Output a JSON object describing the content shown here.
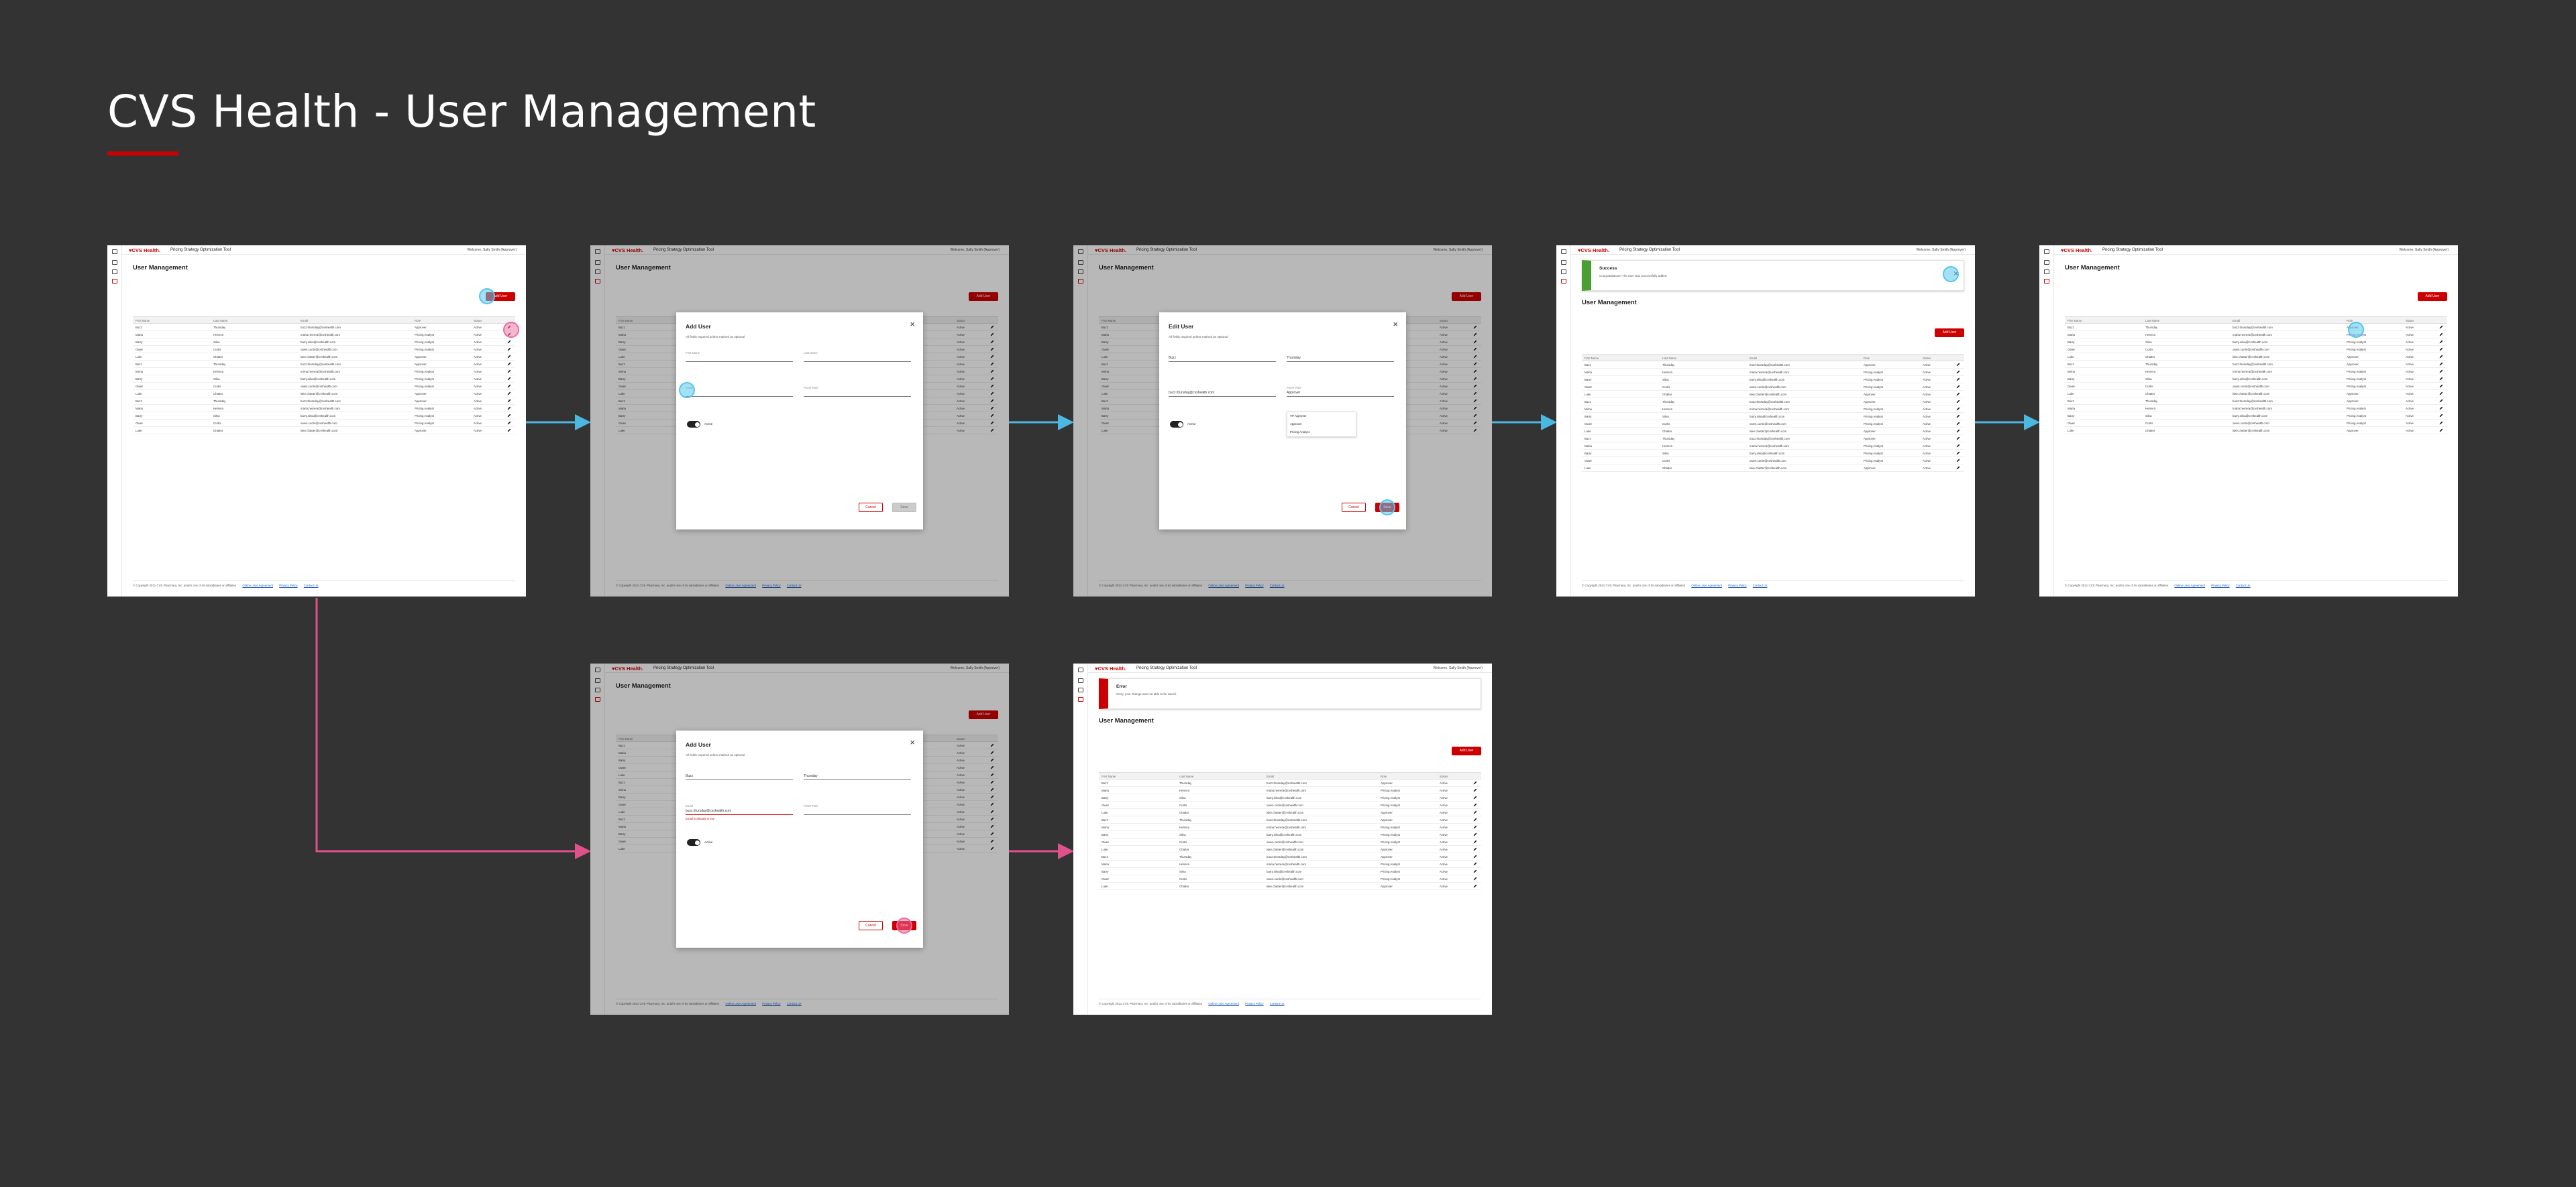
{
  "board_title": "CVS Health - User Management",
  "colors": {
    "brand": "#cc0000",
    "blue_flow": "#4ab8e0",
    "pink_flow": "#e0508a",
    "success": "#4a9e32",
    "error": "#cc0000"
  },
  "app": {
    "logo": "♥CVS Health.",
    "title": "Pricing Strategy Optimization Tool",
    "welcome": "Welcome, Sally Smith (Approver)",
    "page_title": "User Management",
    "add_user": "Add User",
    "footer": {
      "copyright": "© Copyright 2021 CVS Pharmacy, Inc. and/or one of its subsidiaries or affiliates",
      "link1": "Online User Agreement",
      "link2": "Privacy Policy",
      "link3": "Contact Us"
    }
  },
  "table": {
    "headers": [
      "First Name",
      "Last Name",
      "Email",
      "Role",
      "Status"
    ],
    "rows": [
      [
        "Buzz",
        "Thursday",
        "buzz.thursday@cvshealth.com",
        "Approver",
        "Active"
      ],
      [
        "Maria",
        "Herrera",
        "maria.herrera@cvshealth.com",
        "Pricing Analyst",
        "Active"
      ],
      [
        "Barry",
        "Silva",
        "barry.silva@cvshealth.com",
        "Pricing Analyst",
        "Active"
      ],
      [
        "Owen",
        "Curtis",
        "owen.curtis@cvshealth.com",
        "Pricing Analyst",
        "Active"
      ],
      [
        "Luke",
        "Chatter",
        "luke.chatter@cvshealth.com",
        "Approver",
        "Active"
      ],
      [
        "Buzz",
        "Thursday",
        "buzz.thursday@cvshealth.com",
        "Approver",
        "Active"
      ],
      [
        "Mirna",
        "Herrera",
        "mirna.herrera@cvshealth.com",
        "Pricing Analyst",
        "Active"
      ],
      [
        "Barry",
        "Silva",
        "barry.silva@cvshealth.com",
        "Pricing Analyst",
        "Active"
      ],
      [
        "Owen",
        "Curtis",
        "owen.curtis@cvshealth.com",
        "Pricing Analyst",
        "Active"
      ],
      [
        "Luke",
        "Chatter",
        "luke.chatter@cvshealth.com",
        "Approver",
        "Active"
      ],
      [
        "Buzz",
        "Thursday",
        "buzz.thursday@cvshealth.com",
        "Approver",
        "Active"
      ],
      [
        "Maria",
        "Herrera",
        "maria.herrera@cvshealth.com",
        "Pricing Analyst",
        "Active"
      ],
      [
        "Barry",
        "Silva",
        "barry.silva@cvshealth.com",
        "Pricing Analyst",
        "Active"
      ],
      [
        "Owen",
        "Curtis",
        "owen.curtis@cvshealth.com",
        "Pricing Analyst",
        "Active"
      ],
      [
        "Luke",
        "Chatter",
        "luke.chatter@cvshealth.com",
        "Approver",
        "Active"
      ]
    ]
  },
  "add_modal": {
    "title": "Add User",
    "note": "All fields required unless marked as optional",
    "first": "First Name",
    "last": "Last Name",
    "email": "Email",
    "role": "PSOT Role",
    "toggle": "Active",
    "cancel": "Cancel",
    "save": "Save"
  },
  "edit_modal": {
    "title": "Edit User",
    "note": "All fields required unless marked as optional",
    "first": "Buzz",
    "last": "Thursday",
    "email": "buzz.thursday@cvshealth.com",
    "role_label": "PSOT Role",
    "role": "Approver",
    "options": [
      "VP Approver",
      "Approver",
      "Pricing Analyst"
    ],
    "toggle": "Active",
    "cancel": "Cancel",
    "save": "Save"
  },
  "error_modal": {
    "title": "Add User",
    "note": "All fields required unless marked as optional",
    "first": "Buzz",
    "last": "Thursday",
    "email_label": "Email",
    "email": "buzz.thursday@cvshealth.com",
    "email_error": "Email is already in use",
    "role": "PSOT Role",
    "toggle": "Active",
    "cancel": "Cancel",
    "save": "Save"
  },
  "success_alert": {
    "title": "Success",
    "message": "Congratulations! The user was successfully added."
  },
  "error_alert": {
    "title": "Error",
    "message": "Sorry, your change was not able to be saved."
  }
}
